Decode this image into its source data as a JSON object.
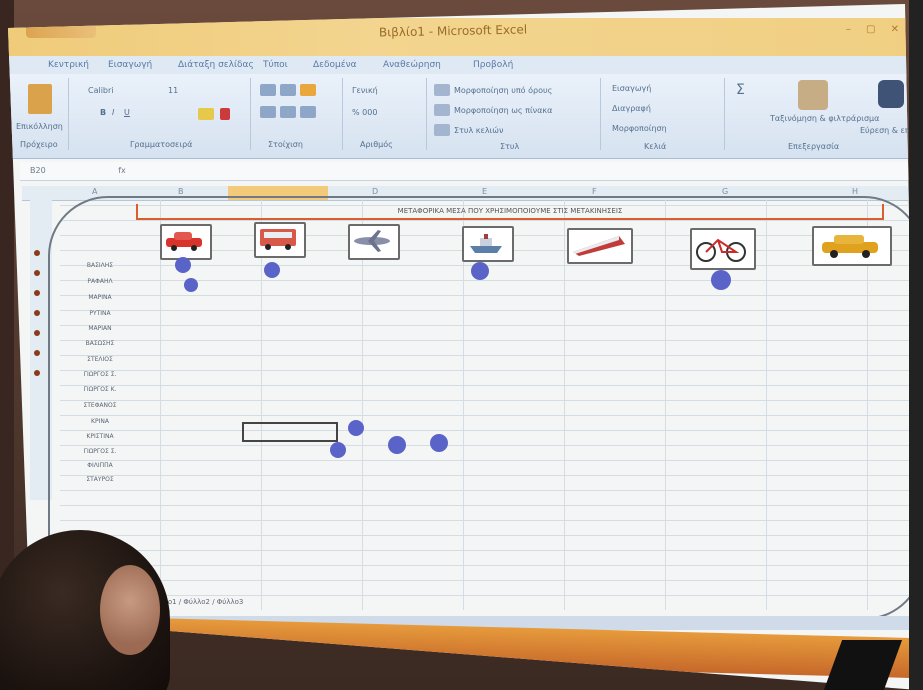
{
  "window": {
    "title": "Βιβλίο1 - Microsoft Excel",
    "controls": "– ▢ ✕"
  },
  "ribbon": {
    "tabs": [
      "Κεντρική",
      "Εισαγωγή",
      "Διάταξη σελίδας",
      "Τύποι",
      "Δεδομένα",
      "Αναθεώρηση",
      "Προβολή"
    ],
    "groups": [
      "Πρόχειρο",
      "Γραμματοσειρά",
      "Στοίχιση",
      "Αριθμός",
      "Στυλ",
      "Κελιά",
      "Επεξεργασία"
    ],
    "font_name": "Calibri",
    "font_size": "11",
    "number_format": "Γενική",
    "styles": [
      "Μορφοποίηση υπό όρους",
      "Μορφοποίηση ως πίνακα",
      "Στυλ κελιών"
    ],
    "cells": [
      "Εισαγωγή",
      "Διαγραφή",
      "Μορφοποίηση"
    ],
    "edit": [
      "Ταξινόμηση & φιλτράρισμα",
      "Εύρεση & επιλογή"
    ],
    "paste": "Επικόλληση"
  },
  "formula_bar": {
    "name_box": "B20",
    "fx": "fx"
  },
  "columns": [
    "A",
    "B",
    "C",
    "D",
    "E",
    "F",
    "G",
    "H"
  ],
  "sheet": {
    "heading": "ΜΕΤΑΦΟΡΙΚΑ ΜΕΣΑ ΠΟΥ ΧΡΗΣΙΜΟΠΟΙΟΥΜΕ ΣΤΙΣ ΜΕΤΑΚΙΝΗΣΕΙΣ",
    "vehicles": [
      "car-icon",
      "bus-icon",
      "airplane-icon",
      "ship-icon",
      "train-icon",
      "bicycle-icon",
      "taxi-icon"
    ],
    "names": [
      "ΒΑΣΙΛΗΣ",
      "ΡΑΦΑΗΛ",
      "ΜΑΡΙΝΑ",
      "ΡΥΤΙΝΑ",
      "ΜΑΡΙΑΝ",
      "ΒΑΣΩΣΗΣ",
      "ΣΤΕΛΙΟΣ",
      "ΓΙΩΡΓΟΣ Σ.",
      "ΓΙΩΡΓΟΣ Κ.",
      "ΣΤΕΦΑΝΟΣ",
      "ΚΡΙΝΑ",
      "ΚΡΙΣΤΙΝΑ",
      "ΓΙΩΡΓΟΣ Σ.",
      "ΦΙΛΙΠΠΑ",
      "ΣΤΑΥΡΟΣ"
    ]
  },
  "sheet_tabs": "Φύλλο1 / Φύλλο2 / Φύλλο3",
  "colors": {
    "titlebar": "#efcb7a",
    "accent_dot": "#5a63c8",
    "heading_border": "#d9602e",
    "taskbar": "#e79b3c"
  }
}
